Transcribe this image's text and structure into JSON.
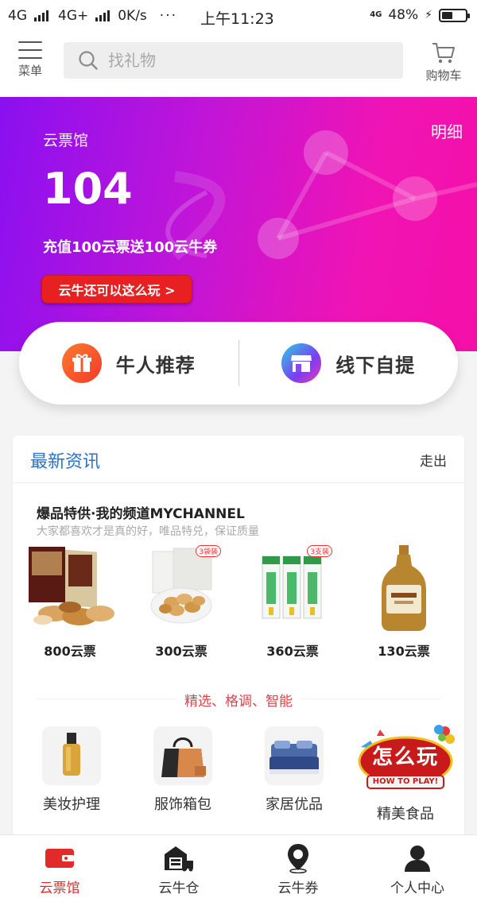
{
  "status_bar": {
    "network_1": "4G",
    "network_2": "4G+",
    "speed": "0K/s",
    "dots": "···",
    "time": "上午11:23",
    "net_badge": "4G",
    "battery_pct": "48%",
    "battery_level": 0.48
  },
  "topnav": {
    "menu_label": "菜单",
    "search_placeholder": "找礼物",
    "cart_label": "购物车"
  },
  "hero": {
    "title": "云票馆",
    "detail_link": "明细",
    "value": "104",
    "promo": "充值100云票送100云牛券",
    "button": "云牛还可以这么玩 >"
  },
  "quick_actions": [
    {
      "label": "牛人推荐",
      "icon": "gift-icon"
    },
    {
      "label": "线下自提",
      "icon": "store-icon"
    }
  ],
  "news": {
    "title": "最新资讯",
    "more": "走出",
    "featured_title": "爆品特供·我的频道MYCHANNEL",
    "featured_sub": "大家都喜欢才是真的好，唯品特兑，保证质量",
    "products": [
      {
        "name": "gift-box-snacks",
        "price": "800云票",
        "tag": ""
      },
      {
        "name": "peanuts",
        "price": "300云票",
        "tag": "3袋装"
      },
      {
        "name": "toothpaste",
        "price": "360云票",
        "tag": "3支装"
      },
      {
        "name": "liquor-bottle",
        "price": "130云票",
        "tag": ""
      }
    ],
    "slogan": "精选、格调、智能",
    "categories": [
      {
        "label": "美妆护理",
        "icon": "cosmetics-icon"
      },
      {
        "label": "服饰箱包",
        "icon": "handbag-icon"
      },
      {
        "label": "家居优品",
        "icon": "bedding-icon"
      },
      {
        "label": "精美食品",
        "icon": "how-to-play-icon",
        "badge_title": "怎么玩",
        "badge_sub": "HOW TO PLAY!"
      }
    ]
  },
  "tabbar": [
    {
      "label": "云票馆",
      "icon": "wallet-icon",
      "active": true
    },
    {
      "label": "云牛仓",
      "icon": "warehouse-icon",
      "active": false
    },
    {
      "label": "云牛券",
      "icon": "location-pin-icon",
      "active": false
    },
    {
      "label": "个人中心",
      "icon": "user-icon",
      "active": false
    }
  ],
  "colors": {
    "accent_red": "#e22a2a",
    "hero_start": "#8a10f0",
    "hero_end": "#f50fa8",
    "news_title": "#2a72c8"
  }
}
